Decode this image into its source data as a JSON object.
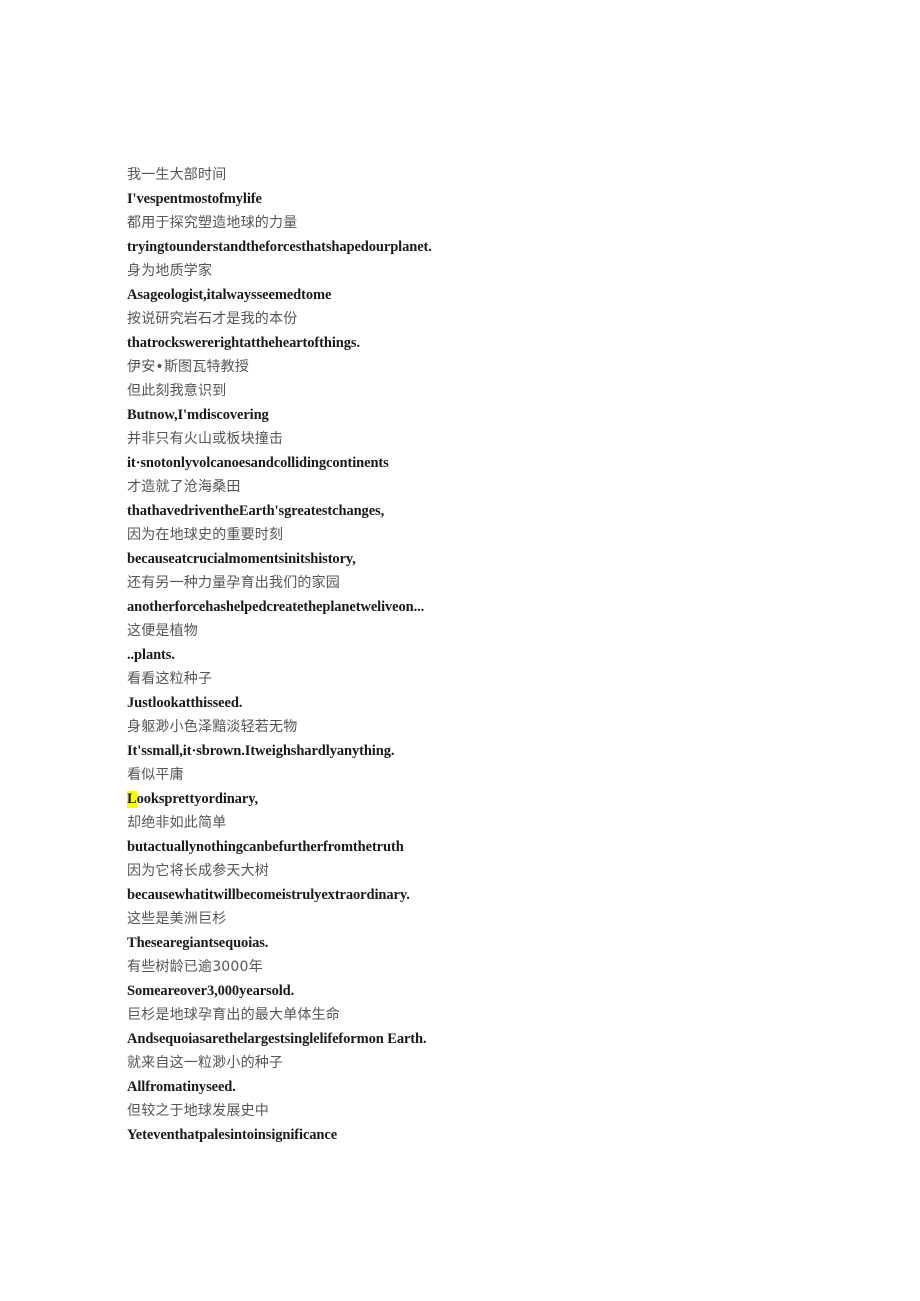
{
  "document": {
    "type": "bilingual-subtitle-transcript",
    "background_color": "#ffffff",
    "zh_text_color": "#555555",
    "en_text_color": "#1a1a1a",
    "highlight_color": "#ffff00",
    "highlight_text": "L",
    "lines": [
      {
        "lang": "zh",
        "text": "我一生大部时间"
      },
      {
        "lang": "en",
        "text": "I'vespentmostofmylife"
      },
      {
        "lang": "zh",
        "text": "都用于探究塑造地球的力量"
      },
      {
        "lang": "en",
        "text": "tryingtounderstandtheforcesthatshapedourplanet."
      },
      {
        "lang": "zh",
        "text": "身为地质学家"
      },
      {
        "lang": "en",
        "text": "Asageologist,italwaysseemedtome"
      },
      {
        "lang": "zh",
        "text": "按说研究岩石才是我的本份"
      },
      {
        "lang": "en",
        "text": "thatrockswererightattheheartofthings."
      },
      {
        "lang": "zh",
        "text": "伊安•斯图瓦特教授"
      },
      {
        "lang": "zh",
        "text": "但此刻我意识到"
      },
      {
        "lang": "en",
        "text": "Butnow,I'mdiscovering"
      },
      {
        "lang": "zh",
        "text": "并非只有火山或板块撞击"
      },
      {
        "lang": "en",
        "text": "it·snotonlyvolcanoesandcollidingcontinents"
      },
      {
        "lang": "zh",
        "text": "才造就了沧海桑田"
      },
      {
        "lang": "en",
        "text": "thathavedriventheEarth'sgreatestchanges,"
      },
      {
        "lang": "zh",
        "text": "因为在地球史的重要时刻"
      },
      {
        "lang": "en",
        "text": "becauseatcrucialmomentsinitshistory,"
      },
      {
        "lang": "zh",
        "text": "还有另一种力量孕育出我们的家园"
      },
      {
        "lang": "en",
        "text": "anotherforcehashelpedcreatetheplanetweliveon..."
      },
      {
        "lang": "zh",
        "text": "这便是植物"
      },
      {
        "lang": "en",
        "text": "..plants."
      },
      {
        "lang": "zh",
        "text": "看看这粒种子"
      },
      {
        "lang": "en",
        "text": "Justlookatthisseed."
      },
      {
        "lang": "zh",
        "text": "身躯渺小色泽黯淡轻若无物"
      },
      {
        "lang": "en",
        "text": "It'ssmall,it·sbrown.Itweighshardlyanything."
      },
      {
        "lang": "zh",
        "text": "看似平庸"
      },
      {
        "lang": "en",
        "text": "ooksprettyordinary,",
        "highlight_prefix": "L"
      },
      {
        "lang": "zh",
        "text": "却绝非如此简单"
      },
      {
        "lang": "en",
        "text": "butactuallynothingcanbefurtherfromthetruth"
      },
      {
        "lang": "zh",
        "text": "因为它将长成参天大树"
      },
      {
        "lang": "en",
        "text": "becausewhatitwillbecomeistrulyextraordinary."
      },
      {
        "lang": "zh",
        "text": "这些是美洲巨杉"
      },
      {
        "lang": "en",
        "text": "Thesearegiantsequoias."
      },
      {
        "lang": "zh",
        "text": "有些树龄已逾3000年"
      },
      {
        "lang": "en",
        "text": "Someareover3,000yearsold."
      },
      {
        "lang": "zh",
        "text": "巨杉是地球孕育出的最大单体生命"
      },
      {
        "lang": "en",
        "text": "Andsequoiasarethelargestsinglelifeformon Earth."
      },
      {
        "lang": "zh",
        "text": "就来自这一粒渺小的种子"
      },
      {
        "lang": "en",
        "text": "Allfromatinyseed."
      },
      {
        "lang": "zh",
        "text": "但较之于地球发展史中"
      },
      {
        "lang": "en",
        "text": "Yeteventhatpalesintoinsignificance"
      }
    ]
  }
}
